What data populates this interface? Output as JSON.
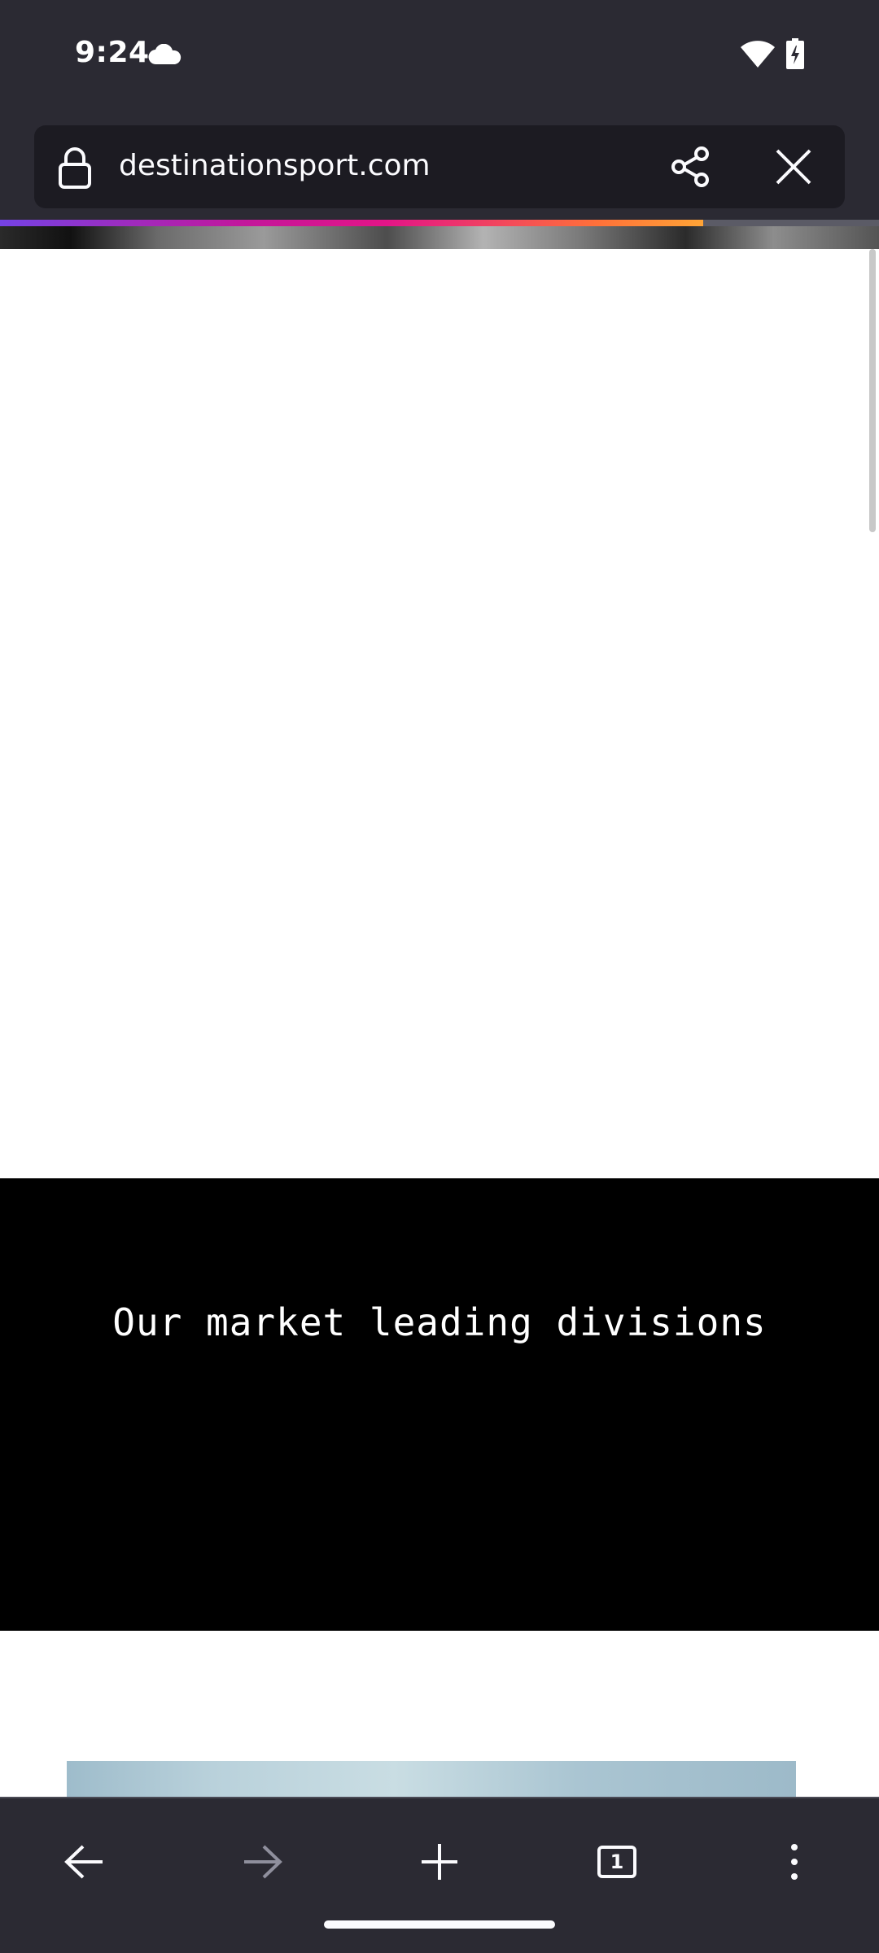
{
  "status_bar": {
    "time": "9:24",
    "icons": [
      "cloud-icon",
      "wifi-icon",
      "battery-charging-icon"
    ]
  },
  "browser": {
    "url": "destinationsport.com",
    "icons": {
      "lock": "lock-icon",
      "share": "share-icon",
      "close": "close-icon"
    },
    "page_load_progress": 0.8
  },
  "page": {
    "divisions_heading": "Our market leading divisions"
  },
  "bottom_nav": {
    "tab_count": "1",
    "icons": [
      "back-arrow-icon",
      "forward-arrow-icon",
      "plus-icon",
      "tabs-icon",
      "more-vertical-icon"
    ],
    "forward_enabled": false
  },
  "colors": {
    "chrome_bg": "#2b2a33",
    "url_field_bg": "#1c1b22",
    "text_light": "#fbfbfe",
    "disabled_icon": "#8f8f9d",
    "divisions_bg": "#000000"
  }
}
